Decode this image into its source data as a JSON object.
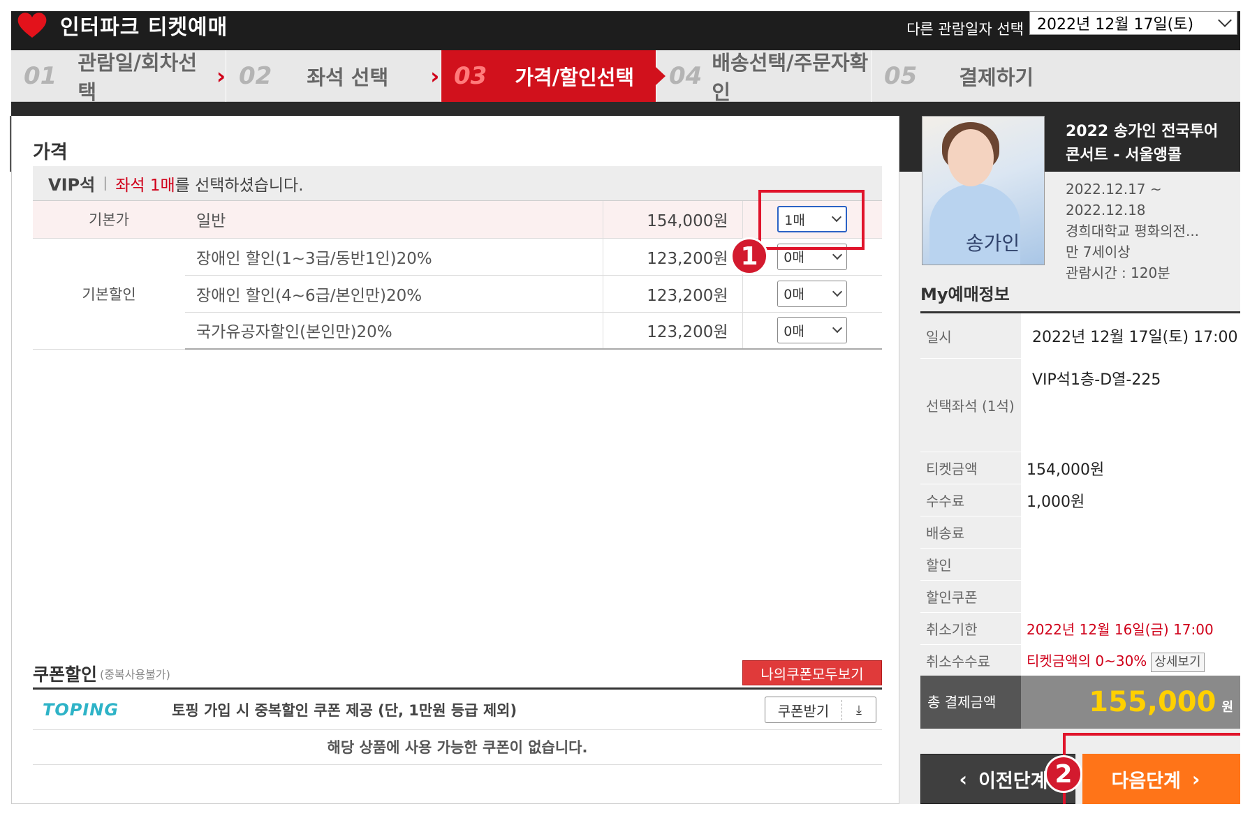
{
  "header": {
    "brand": "인터파크 티켓예매",
    "date_label": "다른 관람일자 선택",
    "date_value": "2022년 12월 17일(토)"
  },
  "steps": [
    {
      "num": "01",
      "label": "관람일/회차선택",
      "active": false
    },
    {
      "num": "02",
      "label": "좌석 선택",
      "active": false
    },
    {
      "num": "03",
      "label": "가격/할인선택",
      "active": true
    },
    {
      "num": "04",
      "label": "배송선택/주문자확인",
      "active": false
    },
    {
      "num": "05",
      "label": "결제하기",
      "active": false
    }
  ],
  "price": {
    "title": "가격",
    "seat_grade": "VIP석",
    "seat_count_red": "좌석 1매",
    "seat_count_rest": "를 선택하셨습니다.",
    "rows": [
      {
        "category": "기본가",
        "name": "일반",
        "amount": "154,000원",
        "qty": "1매"
      },
      {
        "category": "기본할인",
        "name": "장애인 할인(1~3급/동반1인)20%",
        "amount": "123,200원",
        "qty": "0매"
      },
      {
        "category": "",
        "name": "장애인 할인(4~6급/본인만)20%",
        "amount": "123,200원",
        "qty": "0매"
      },
      {
        "category": "",
        "name": "국가유공자할인(본인만)20%",
        "amount": "123,200원",
        "qty": "0매"
      }
    ]
  },
  "coupon": {
    "title": "쿠폰할인",
    "subtitle": "(중복사용불가)",
    "my_coupon_button": "나의쿠폰모두보기",
    "toping_logo": "TOPING",
    "toping_text": "토핑 가입 시 중복할인 쿠폰 제공 (단, 1만원 등급 제외)",
    "get_button": "쿠폰받기",
    "download_glyph": "⤓",
    "empty_message": "해당 상품에 사용 가능한 쿠폰이 없습니다."
  },
  "performance": {
    "title": "2022 송가인 전국투어 콘서트 - 서울앵콜",
    "poster_title": "송가인",
    "period": "2022.12.17 ~ 2022.12.18",
    "venue": "경희대학교 평화의전...",
    "age": "만 7세이상",
    "runtime": "관람시간 : 120분"
  },
  "my_booking": {
    "title": "My예매정보",
    "rows": [
      {
        "key": "일시",
        "value": "2022년 12월 17일(토) 17:00"
      },
      {
        "key": "선택좌석 (1석)",
        "value": "VIP석1층-D열-225"
      },
      {
        "key": "티켓금액",
        "value": "154,000원"
      },
      {
        "key": "수수료",
        "value": "1,000원"
      },
      {
        "key": "배송료",
        "value": ""
      },
      {
        "key": "할인",
        "value": ""
      },
      {
        "key": "할인쿠폰",
        "value": ""
      },
      {
        "key": "취소기한",
        "value": "2022년 12월 16일(금) 17:00"
      },
      {
        "key": "취소수수료",
        "value": "티켓금액의 0~30%"
      }
    ],
    "detail_button": "상세보기",
    "total_label": "총 결제금액",
    "total_amount": "155,000",
    "total_unit": "원"
  },
  "nav": {
    "prev_label": "이전단계",
    "next_label": "다음단계"
  },
  "annotations": {
    "badge1": "1",
    "badge2": "2"
  },
  "colors": {
    "active_step": "#d1111c",
    "accent_red": "#d0001a",
    "next_button": "#ff7418",
    "total_amount": "#ffd000",
    "focus_blue": "#2b62c5"
  }
}
